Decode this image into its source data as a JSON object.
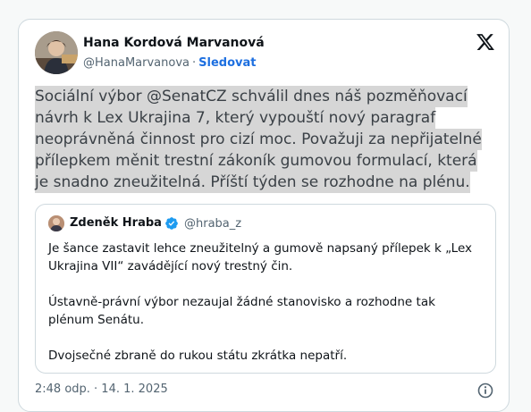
{
  "author": {
    "name": "Hana Kordová Marvanová",
    "handle": "@HanaMarvanova",
    "separator": "·",
    "follow_label": "Sledovat"
  },
  "tweet": {
    "lines": [
      "Sociální výbor @SenatCZ schválil dnes náš pozměňovací",
      "návrh k Lex Ukrajina 7, který vypouští nový paragraf",
      "neoprávněná činnost pro cizí moc. Považuji za nepřijatelné",
      "přílepkem měnit trestní zákoník gumovou formulací, která",
      "je snadno zneužitelná. Příští týden se rozhodne na plénu."
    ]
  },
  "quoted": {
    "name": "Zdeněk Hraba",
    "handle": "@hraba_z",
    "paragraphs": [
      "Je šance zastavit lehce zneužitelný a gumově napsaný přílepek k „Lex Ukrajina VII“ zavádějící nový trestný čin.",
      "Ústavně-právní výbor nezaujal žádné stanovisko a rozhodne tak plénum Senátu.",
      "Dvojsečné zbraně do rukou státu zkrátka nepatří."
    ]
  },
  "footer": {
    "timestamp": "2:48 odp. · 14. 1. 2025"
  },
  "icons": {
    "platform_logo": "x-logo-icon",
    "verified": "verified-badge-icon",
    "info": "info-icon"
  },
  "colors": {
    "link": "#1d6fe0",
    "verified": "#1d9bf0",
    "highlight": "#d6d6d6"
  }
}
